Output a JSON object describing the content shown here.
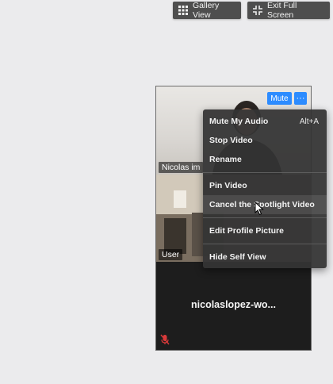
{
  "toolbar": {
    "gallery_view_label": "Gallery View",
    "exit_full_screen_label": "Exit Full Screen"
  },
  "tiles": {
    "nicolas": {
      "name": "Nicolas im"
    },
    "user": {
      "name": "User"
    },
    "self": {
      "name": "nicolaslopez-wo..."
    }
  },
  "controls": {
    "mute_label": "Mute",
    "more_label": "···"
  },
  "context_menu": {
    "items": [
      {
        "label": "Mute My Audio",
        "shortcut": "Alt+A"
      },
      {
        "label": "Stop Video",
        "shortcut": ""
      },
      {
        "label": "Rename",
        "shortcut": ""
      },
      {
        "label": "Pin Video",
        "shortcut": ""
      },
      {
        "label": "Cancel the Spotlight Video",
        "shortcut": ""
      },
      {
        "label": "Edit Profile Picture",
        "shortcut": ""
      },
      {
        "label": "Hide Self View",
        "shortcut": ""
      }
    ],
    "hovered_item": "Cancel the Spotlight Video"
  },
  "colors": {
    "background": "#ebebed",
    "toolbar_button": "#4e4e4e",
    "accent_blue": "#2d8cff",
    "menu_bg": "#343434",
    "muted_red": "#d93a3a"
  }
}
